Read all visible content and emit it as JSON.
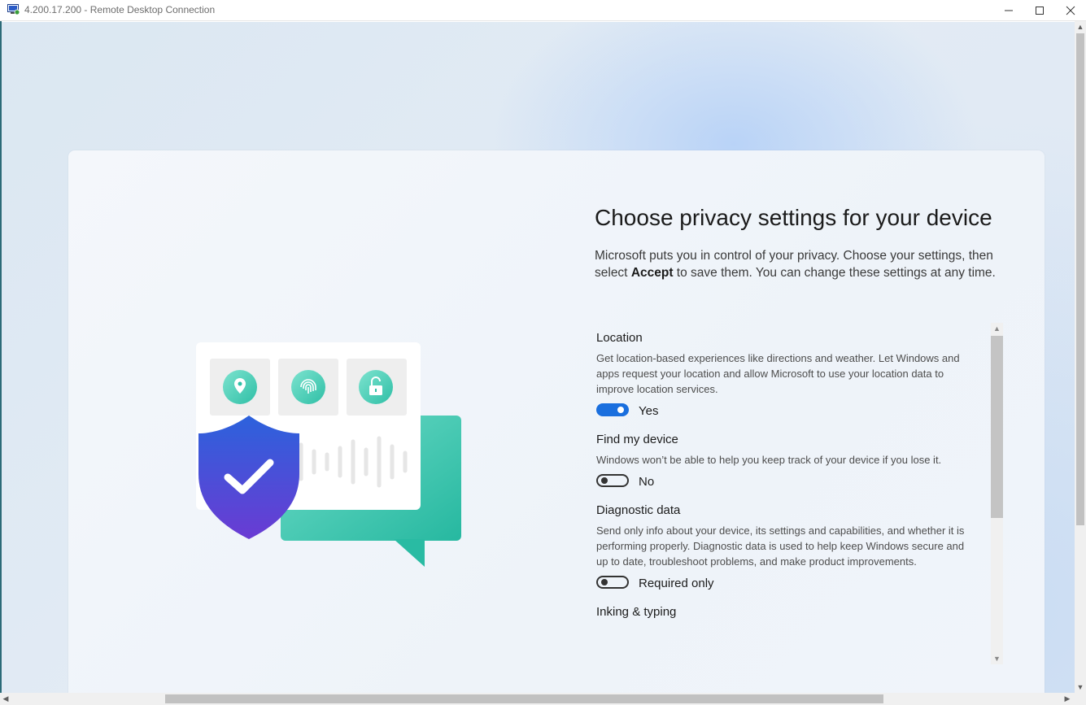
{
  "window": {
    "title": "4.200.17.200 - Remote Desktop Connection",
    "icon": "remote-desktop-icon",
    "minimize_icon": "minimize-icon",
    "maximize_icon": "maximize-icon",
    "close_icon": "close-icon"
  },
  "page": {
    "heading": "Choose privacy settings for your device",
    "intro_before": "Microsoft puts you in control of your privacy. Choose your settings, then select ",
    "intro_bold": "Accept",
    "intro_after": " to save them. You can change these settings at any time."
  },
  "settings": [
    {
      "title": "Location",
      "description": "Get location-based experiences like directions and weather. Let Windows and apps request your location and allow Microsoft to use your location data to improve location services.",
      "toggle_state": "on",
      "toggle_label": "Yes"
    },
    {
      "title": "Find my device",
      "description": "Windows won’t be able to help you keep track of your device if you lose it.",
      "toggle_state": "off",
      "toggle_label": "No"
    },
    {
      "title": "Diagnostic data",
      "description": "Send only info about your device, its settings and capabilities, and whether it is performing properly. Diagnostic data is used to help keep Windows secure and up to date, troubleshoot problems, and make product improvements.",
      "toggle_state": "off",
      "toggle_label": "Required only"
    },
    {
      "title": "Inking & typing"
    }
  ],
  "illustration": {
    "icons": [
      "location-pin-icon",
      "fingerprint-icon",
      "unlock-icon",
      "shield-check-icon",
      "chat-bubble-icon",
      "waveform-icon"
    ],
    "accent_teal": "#3fc9b2",
    "accent_blue": "#2b5fd9",
    "accent_purple": "#6b3fd1"
  },
  "colors": {
    "toggle_on": "#1a6fde",
    "text_primary": "#1b1b1b"
  }
}
